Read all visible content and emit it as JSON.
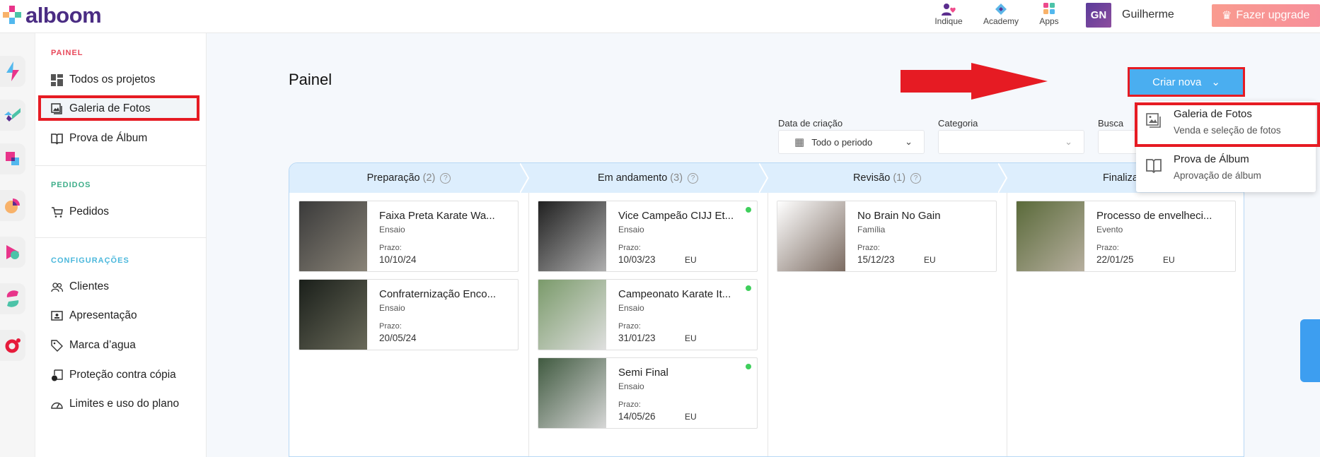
{
  "header": {
    "logo": "alboom",
    "links": [
      {
        "label": "Indique",
        "icon": "refer-icon"
      },
      {
        "label": "Academy",
        "icon": "academy-icon"
      },
      {
        "label": "Apps",
        "icon": "apps-icon"
      }
    ],
    "avatar_initials": "GN",
    "user_name": "Guilherme",
    "upgrade_label": "Fazer upgrade"
  },
  "sidebar": {
    "painel_label": "PAINEL",
    "painel_items": [
      {
        "label": "Todos os projetos"
      },
      {
        "label": "Galeria de Fotos"
      },
      {
        "label": "Prova de Álbum"
      }
    ],
    "pedidos_label": "PEDIDOS",
    "pedidos_items": [
      {
        "label": "Pedidos"
      }
    ],
    "config_label": "CONFIGURAÇÕES",
    "config_items": [
      {
        "label": "Clientes"
      },
      {
        "label": "Apresentação"
      },
      {
        "label": "Marca d’agua"
      },
      {
        "label": "Proteção contra cópia"
      },
      {
        "label": "Limites e uso do plano"
      }
    ]
  },
  "main": {
    "title": "Painel",
    "create_button": "Criar nova",
    "filters": {
      "date_label": "Data de criação",
      "date_value": "Todo o periodo",
      "category_label": "Categoria",
      "category_value": "",
      "search_label": "Busca"
    },
    "dropdown": [
      {
        "title": "Galeria de Fotos",
        "subtitle": "Venda e seleção de fotos"
      },
      {
        "title": "Prova de Álbum",
        "subtitle": "Aprovação de álbum"
      }
    ],
    "columns": [
      {
        "name": "Preparação",
        "count": "(2)",
        "cards": [
          {
            "title": "Faixa Preta Karate Wa...",
            "category": "Ensaio",
            "deadline_label": "Prazo:",
            "deadline": "10/10/24",
            "owner": "",
            "active": false
          },
          {
            "title": "Confraternização Enco...",
            "category": "Ensaio",
            "deadline_label": "Prazo:",
            "deadline": "20/05/24",
            "owner": "",
            "active": false
          }
        ]
      },
      {
        "name": "Em andamento",
        "count": "(3)",
        "cards": [
          {
            "title": "Vice Campeão CIJJ Et...",
            "category": "Ensaio",
            "deadline_label": "Prazo:",
            "deadline": "10/03/23",
            "owner": "EU",
            "active": true
          },
          {
            "title": "Campeonato Karate It...",
            "category": "Ensaio",
            "deadline_label": "Prazo:",
            "deadline": "31/01/23",
            "owner": "EU",
            "active": true
          },
          {
            "title": "Semi Final",
            "category": "Ensaio",
            "deadline_label": "Prazo:",
            "deadline": "14/05/26",
            "owner": "EU",
            "active": true
          }
        ]
      },
      {
        "name": "Revisão",
        "count": "(1)",
        "cards": [
          {
            "title": "No Brain No Gain",
            "category": "Família",
            "deadline_label": "Prazo:",
            "deadline": "15/12/23",
            "owner": "EU",
            "active": false
          }
        ]
      },
      {
        "name": "Finalizado",
        "count": "",
        "cards": [
          {
            "title": "Processo de envelheci...",
            "category": "Evento",
            "deadline_label": "Prazo:",
            "deadline": "22/01/25",
            "owner": "EU",
            "active": false
          }
        ]
      }
    ]
  },
  "colors": {
    "brand": "#4a2c83",
    "accent": "#4aaef0",
    "annotation_red": "#e61b23",
    "upgrade": "#f99b8f",
    "active_dot": "#3fcf5c"
  }
}
